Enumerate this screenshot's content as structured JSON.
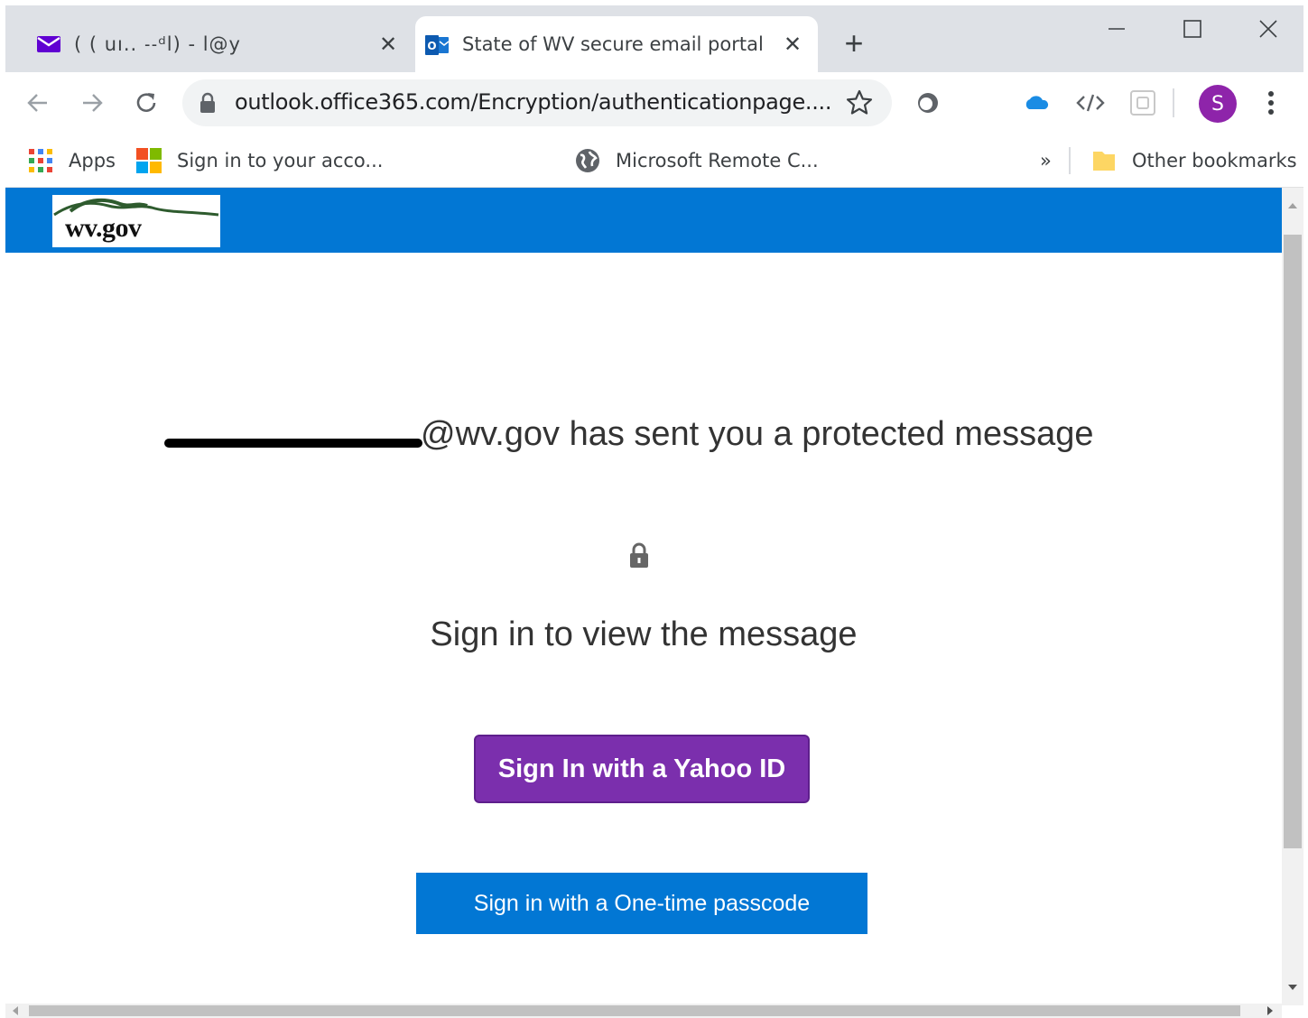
{
  "tabs": [
    {
      "title": "( (     uı.. ˗˗ᵈl) -              l@у",
      "active": false,
      "icon": "yahoo-mail-icon"
    },
    {
      "title": "State of WV secure email portal",
      "active": true,
      "icon": "outlook-icon"
    }
  ],
  "new_tab_label": "+",
  "tab_close_glyph": "✕",
  "address_bar": {
    "url": "outlook.office365.com/Encryption/authenticationpage...."
  },
  "avatar_initial": "S",
  "bookmarks": {
    "apps": "Apps",
    "items": [
      "Sign in to your acco...",
      "Microsoft Remote C..."
    ],
    "overflow": "»",
    "other": "Other bookmarks"
  },
  "page": {
    "logo_text": "wv.gov",
    "headline": "@wv.gov has sent you a protected message",
    "subhead": "Sign in to view the message",
    "yahoo_button": "Sign In with a Yahoo ID",
    "otp_button": "Sign in with a One-time passcode"
  },
  "colors": {
    "banner": "#0277d4",
    "yahoo_button": "#7b2fad",
    "otp_button": "#0277d4",
    "avatar": "#8e24aa"
  }
}
